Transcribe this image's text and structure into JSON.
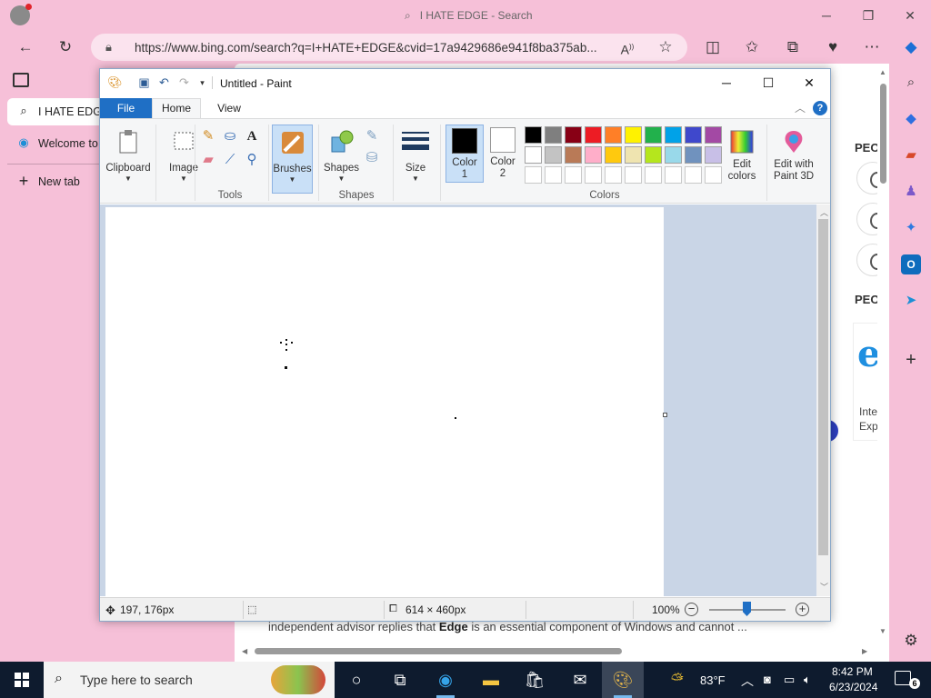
{
  "browser": {
    "title": "I HATE EDGE - Search",
    "url": "https://www.bing.com/search?q=I+HATE+EDGE&cvid=17a9429686e941f8ba375ab...",
    "tabs": [
      {
        "label": "I HATE EDGE",
        "icon": "search-icon"
      },
      {
        "label": "Welcome to",
        "icon": "edge-logo-icon"
      }
    ],
    "new_tab_label": "New tab",
    "snippet_prefix": "independent advisor replies that ",
    "snippet_bold": "Edge",
    "snippet_suffix": " is an essential component of Windows and cannot ...",
    "people_heading_1": "PEO",
    "people_heading_2": "PEO",
    "ie_text_1": "Inte",
    "ie_text_2": "Exp"
  },
  "paint": {
    "title": "Untitled - Paint",
    "tabs": {
      "file": "File",
      "home": "Home",
      "view": "View"
    },
    "ribbon": {
      "clipboard": "Clipboard",
      "image": "Image",
      "tools": "Tools",
      "brushes": "Brushes",
      "shapes": "Shapes",
      "shapes_group": "Shapes",
      "size": "Size",
      "color1_line1": "Color",
      "color1_line2": "1",
      "color2_line1": "Color",
      "color2_line2": "2",
      "edit_colors_line1": "Edit",
      "edit_colors_line2": "colors",
      "paint3d_line1": "Edit with",
      "paint3d_line2": "Paint 3D",
      "colors_group": "Colors"
    },
    "palette_row1": [
      "#000000",
      "#7f7f7f",
      "#880015",
      "#ed1c24",
      "#ff7f27",
      "#fff200",
      "#22b14c",
      "#00a2e8",
      "#3f48cc",
      "#a349a4"
    ],
    "palette_row2": [
      "#ffffff",
      "#c3c3c3",
      "#b97a57",
      "#ffaec9",
      "#ffc90e",
      "#efe4b0",
      "#b5e61d",
      "#99d9ea",
      "#7092be",
      "#c8bfe7"
    ],
    "color1": "#000000",
    "color2": "#ffffff",
    "status": {
      "cursor_pos": "197, 176px",
      "canvas_size": "614 × 460px",
      "zoom": "100%"
    }
  },
  "taskbar": {
    "search_placeholder": "Type here to search",
    "weather": "83°F",
    "time": "8:42 PM",
    "date": "6/23/2024",
    "notification_count": "6"
  }
}
